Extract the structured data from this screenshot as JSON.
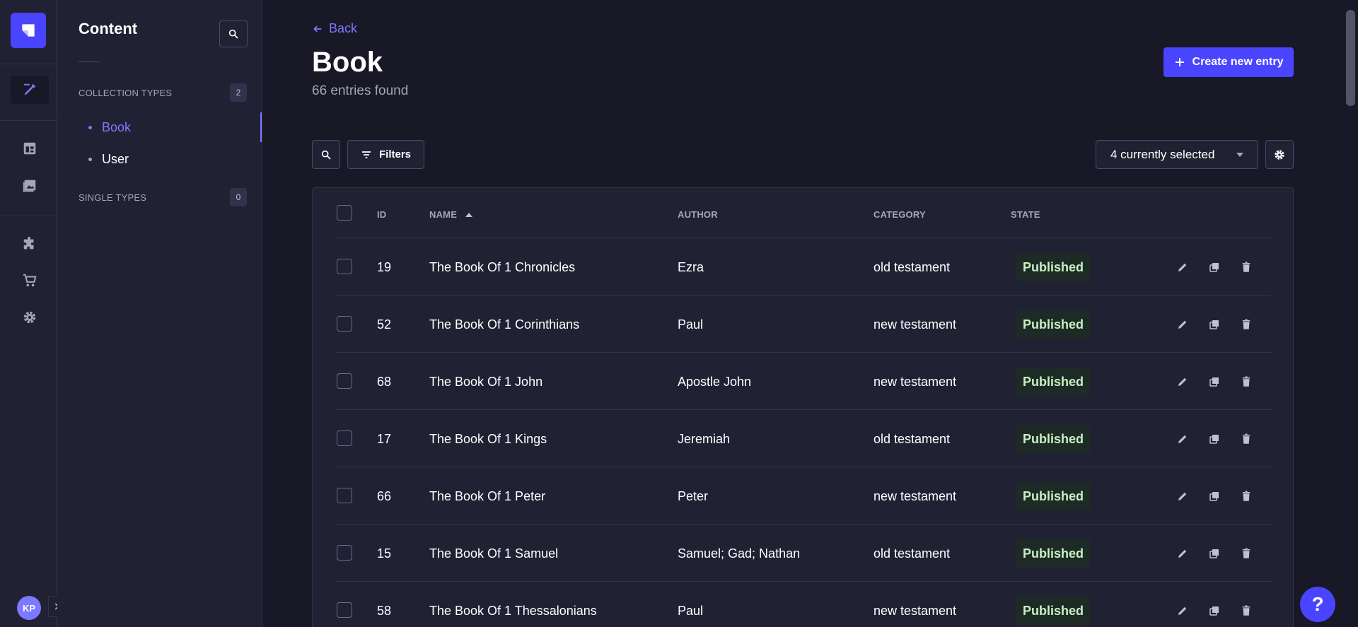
{
  "rail": {
    "avatar_initials": "KP",
    "icons": [
      "content-manager-icon",
      "content-type-builder-icon",
      "media-library-icon",
      "plugins-icon",
      "marketplace-icon",
      "settings-icon"
    ]
  },
  "subnav": {
    "title": "Content",
    "collection_types_label": "COLLECTION TYPES",
    "collection_types_count": "2",
    "collection_items": [
      {
        "label": "Book"
      },
      {
        "label": "User"
      }
    ],
    "single_types_label": "SINGLE TYPES",
    "single_types_count": "0"
  },
  "header": {
    "back_label": "Back",
    "title": "Book",
    "subtitle": "66 entries found",
    "create_label": "Create new entry"
  },
  "toolbar": {
    "filters_label": "Filters",
    "columns_selected": "4 currently selected"
  },
  "table": {
    "headers": {
      "id": "ID",
      "name": "NAME",
      "author": "AUTHOR",
      "category": "CATEGORY",
      "state": "STATE"
    },
    "rows": [
      {
        "id": "19",
        "name": "The Book Of 1 Chronicles",
        "author": "Ezra",
        "category": "old testament",
        "state": "Published"
      },
      {
        "id": "52",
        "name": "The Book Of 1 Corinthians",
        "author": "Paul",
        "category": "new testament",
        "state": "Published"
      },
      {
        "id": "68",
        "name": "The Book Of 1 John",
        "author": "Apostle John",
        "category": "new testament",
        "state": "Published"
      },
      {
        "id": "17",
        "name": "The Book Of 1 Kings",
        "author": "Jeremiah",
        "category": "old testament",
        "state": "Published"
      },
      {
        "id": "66",
        "name": "The Book Of 1 Peter",
        "author": "Peter",
        "category": "new testament",
        "state": "Published"
      },
      {
        "id": "15",
        "name": "The Book Of 1 Samuel",
        "author": "Samuel; Gad; Nathan",
        "category": "old testament",
        "state": "Published"
      },
      {
        "id": "58",
        "name": "The Book Of 1 Thessalonians",
        "author": "Paul",
        "category": "new testament",
        "state": "Published"
      }
    ]
  },
  "help_label": "?",
  "colors": {
    "accent": "#4945ff",
    "accent_light": "#7b79ff",
    "background": "#181826",
    "panel": "#212134",
    "published_text": "#c6f0c2"
  }
}
